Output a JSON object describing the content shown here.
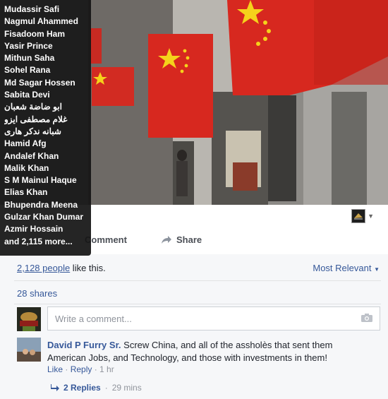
{
  "tooltip": {
    "names": [
      "Mudassir Safi",
      "Nagmul Ahammed",
      "Fisadoom Ham",
      "Yasir Prince",
      "Mithun Saha",
      "Sohel Rana",
      "Md Sagar Hossen",
      "Sabita Devi",
      "ابو ضاضة شعبان",
      "غلام مصطفى ايزو",
      "شبانه ندکر هاری",
      "Hamid Afg",
      "Andalef Khan",
      "Malik Khan",
      "S M Mainul Haque",
      "Elias Khan",
      "Bhupendra Meena",
      "Gulzar Khan Dumar",
      "Azmir Hossain"
    ],
    "more": "and 2,115 more..."
  },
  "actions": {
    "comment": "Comment",
    "share": "Share"
  },
  "likes": {
    "link": "2,128 people",
    "suffix": " like this."
  },
  "sort": {
    "label": "Most Relevant"
  },
  "shares": {
    "label": "28 shares"
  },
  "composer": {
    "placeholder": "Write a comment..."
  },
  "comment": {
    "author": "David P Furry Sr.",
    "text": " Screw China, and all of the assholès that sent them American Jobs, and Technology, and those with investments in them!",
    "like": "Like",
    "sep1": " · ",
    "reply": "Reply",
    "sep2": " · ",
    "time": "1 hr"
  },
  "replies": {
    "label": "2 Replies",
    "sep": " · ",
    "time": "29 mins"
  },
  "colors": {
    "link": "#365899",
    "flag_red": "#d7281f",
    "flag_star": "#f5d21b"
  }
}
